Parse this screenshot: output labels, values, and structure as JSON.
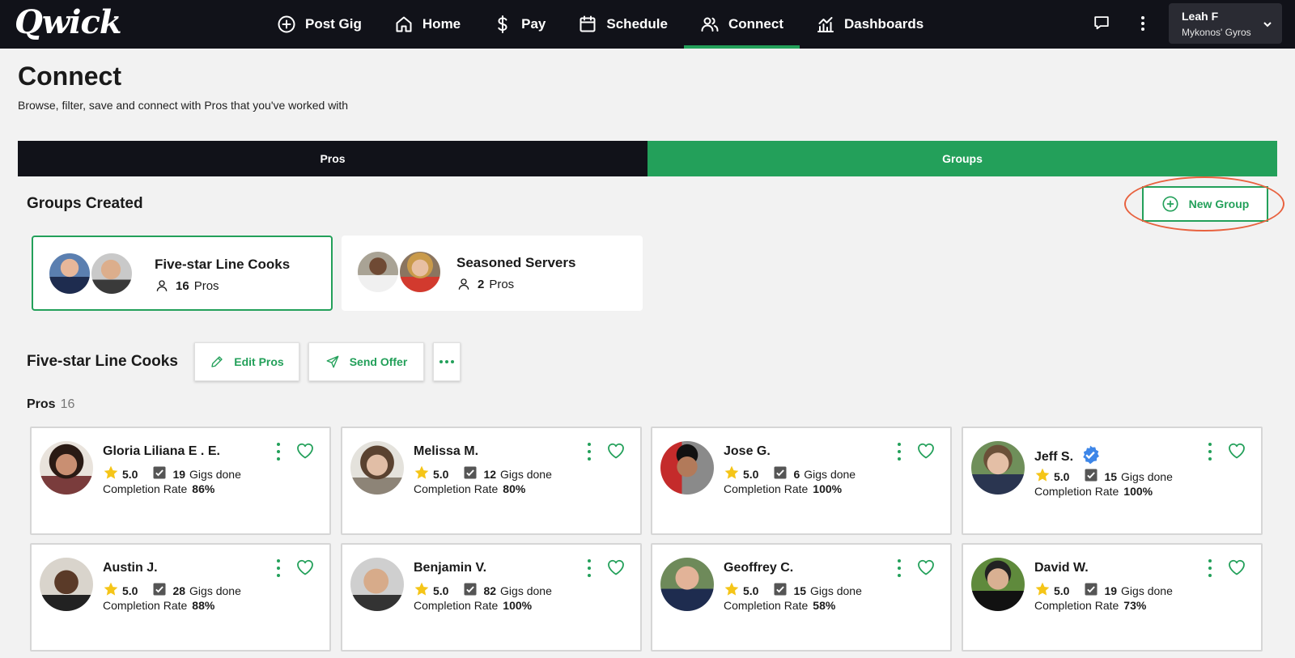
{
  "brand": {
    "logo": "Qwick",
    "accent_color": "#23a05a",
    "nav_bg": "#111219"
  },
  "nav": {
    "items": [
      {
        "label": "Post Gig",
        "icon": "plus-circle-icon"
      },
      {
        "label": "Home",
        "icon": "home-icon"
      },
      {
        "label": "Pay",
        "icon": "dollar-icon"
      },
      {
        "label": "Schedule",
        "icon": "calendar-icon"
      },
      {
        "label": "Connect",
        "icon": "users-icon",
        "active": true
      },
      {
        "label": "Dashboards",
        "icon": "bar-chart-icon"
      }
    ],
    "user": {
      "name": "Leah F",
      "org": "Mykonos' Gyros"
    }
  },
  "page": {
    "title": "Connect",
    "subtitle": "Browse, filter, save and connect with Pros that you've worked with"
  },
  "tabs": [
    {
      "label": "Pros",
      "active": false
    },
    {
      "label": "Groups",
      "active": true
    }
  ],
  "groups_section": {
    "title": "Groups Created",
    "new_group_label": "New Group",
    "groups": [
      {
        "name": "Five-star Line Cooks",
        "count": "16",
        "count_label": "Pros",
        "selected": true
      },
      {
        "name": "Seasoned Servers",
        "count": "2",
        "count_label": "Pros",
        "selected": false
      }
    ]
  },
  "selected_group": {
    "title": "Five-star Line Cooks",
    "edit_label": "Edit Pros",
    "send_offer_label": "Send Offer",
    "pros_label": "Pros",
    "pros_count": "16"
  },
  "pros": [
    {
      "name": "Gloria Liliana E . E.",
      "rating": "5.0",
      "gigs": "19",
      "gigs_label": "Gigs done",
      "completion_label": "Completion Rate",
      "completion": "86%",
      "verified": false
    },
    {
      "name": "Melissa M.",
      "rating": "5.0",
      "gigs": "12",
      "gigs_label": "Gigs done",
      "completion_label": "Completion Rate",
      "completion": "80%",
      "verified": false
    },
    {
      "name": "Jose G.",
      "rating": "5.0",
      "gigs": "6",
      "gigs_label": "Gigs done",
      "completion_label": "Completion Rate",
      "completion": "100%",
      "verified": false
    },
    {
      "name": "Jeff S.",
      "rating": "5.0",
      "gigs": "15",
      "gigs_label": "Gigs done",
      "completion_label": "Completion Rate",
      "completion": "100%",
      "verified": true
    },
    {
      "name": "Austin J.",
      "rating": "5.0",
      "gigs": "28",
      "gigs_label": "Gigs done",
      "completion_label": "Completion Rate",
      "completion": "88%",
      "verified": false
    },
    {
      "name": "Benjamin V.",
      "rating": "5.0",
      "gigs": "82",
      "gigs_label": "Gigs done",
      "completion_label": "Completion Rate",
      "completion": "100%",
      "verified": false
    },
    {
      "name": "Geoffrey C.",
      "rating": "5.0",
      "gigs": "15",
      "gigs_label": "Gigs done",
      "completion_label": "Completion Rate",
      "completion": "58%",
      "verified": false
    },
    {
      "name": "David W.",
      "rating": "5.0",
      "gigs": "19",
      "gigs_label": "Gigs done",
      "completion_label": "Completion Rate",
      "completion": "73%",
      "verified": false
    }
  ]
}
